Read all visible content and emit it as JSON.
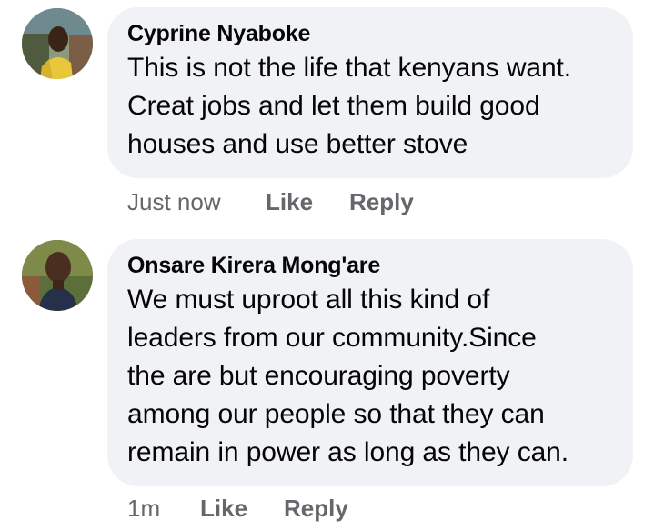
{
  "comments": [
    {
      "author": "Cyprine Nyaboke",
      "text_lines": [
        "This is not the life that kenyans want.",
        "Creat jobs and let them build good",
        "houses and use better stove"
      ],
      "timestamp": "Just now",
      "like_label": "Like",
      "reply_label": "Reply"
    },
    {
      "author": "Onsare Kirera Mong'are",
      "text_lines": [
        "We must uproot all this kind of",
        "leaders from our community.Since",
        "the are but encouraging poverty",
        "among our people so that they can",
        "remain in power as long as they can."
      ],
      "timestamp": "1m",
      "like_label": "Like",
      "reply_label": "Reply"
    }
  ]
}
